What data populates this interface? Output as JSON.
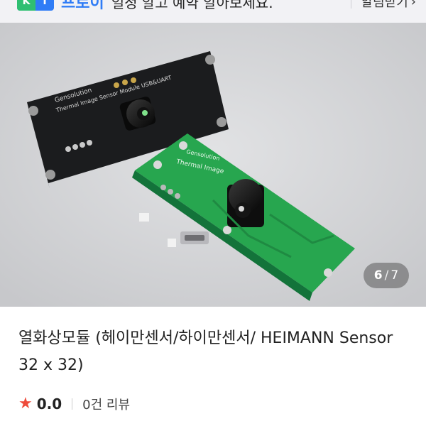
{
  "banner": {
    "badge_left": "K",
    "badge_right": "T",
    "brand": "프로이",
    "text": "일정 알고 예약 알아보세요.",
    "link_label": "알림받기",
    "link_chevron": "›"
  },
  "gallery": {
    "current": "6",
    "total": "7",
    "boards": {
      "black_board_text_logo": "Gensolution",
      "black_board_text_line": "Thermal Image Sensor Module USB&UART",
      "green_board_text_logo": "Gensolution",
      "green_board_text_line": "Thermal Image"
    },
    "colors": {
      "background": "#d5d6d8",
      "black_pcb": "#1b1c1e",
      "green_pcb": "#27a64f"
    }
  },
  "product": {
    "title": "열화상모듈 (헤이만센서/하이만센서/ HEIMANN Sensor 32 x 32)",
    "rating": "0.0",
    "review_count": "0건 리뷰",
    "star_icon": "★",
    "star_color": "#ee4b3b"
  }
}
